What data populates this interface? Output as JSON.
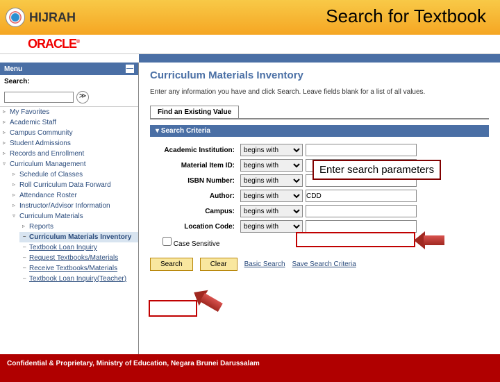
{
  "banner": {
    "logo_text": "HIJRAH",
    "title": "Search for Textbook",
    "oracle": "ORACLE"
  },
  "sidebar": {
    "menu_label": "Menu",
    "search_label": "Search:",
    "items": [
      "My Favorites",
      "Academic Staff",
      "Campus Community",
      "Student Admissions",
      "Records and Enrollment",
      "Curriculum Management"
    ],
    "cm_children": [
      "Schedule of Classes",
      "Roll Curriculum Data Forward",
      "Attendance Roster",
      "Instructor/Advisor Information",
      "Curriculum Materials"
    ],
    "cm_materials_children": [
      "Reports",
      "Curriculum Materials Inventory",
      "Textbook Loan Inquiry",
      "Request Textbooks/Materials",
      "Receive Textbooks/Materials",
      "Textbook Loan Inquiry(Teacher)"
    ]
  },
  "content": {
    "page_title": "Curriculum Materials Inventory",
    "help": "Enter any information you have and click Search. Leave fields blank for a list of all values.",
    "tab": "Find an Existing Value",
    "criteria_head": "Search Criteria",
    "fields": {
      "institution": {
        "label": "Academic Institution:",
        "op": "begins with",
        "val": ""
      },
      "material_id": {
        "label": "Material Item ID:",
        "op": "begins with",
        "val": ""
      },
      "isbn": {
        "label": "ISBN Number:",
        "op": "begins with",
        "val": ""
      },
      "author": {
        "label": "Author:",
        "op": "begins with",
        "val": "CDD"
      },
      "campus": {
        "label": "Campus:",
        "op": "begins with",
        "val": ""
      },
      "location": {
        "label": "Location Code:",
        "op": "begins with",
        "val": ""
      }
    },
    "case_sensitive": "Case Sensitive",
    "buttons": {
      "search": "Search",
      "clear": "Clear",
      "basic": "Basic Search",
      "save": "Save Search Criteria"
    }
  },
  "callout": "Enter search parameters",
  "footer": "Confidential & Proprietary, Ministry of Education, Negara Brunei Darussalam"
}
